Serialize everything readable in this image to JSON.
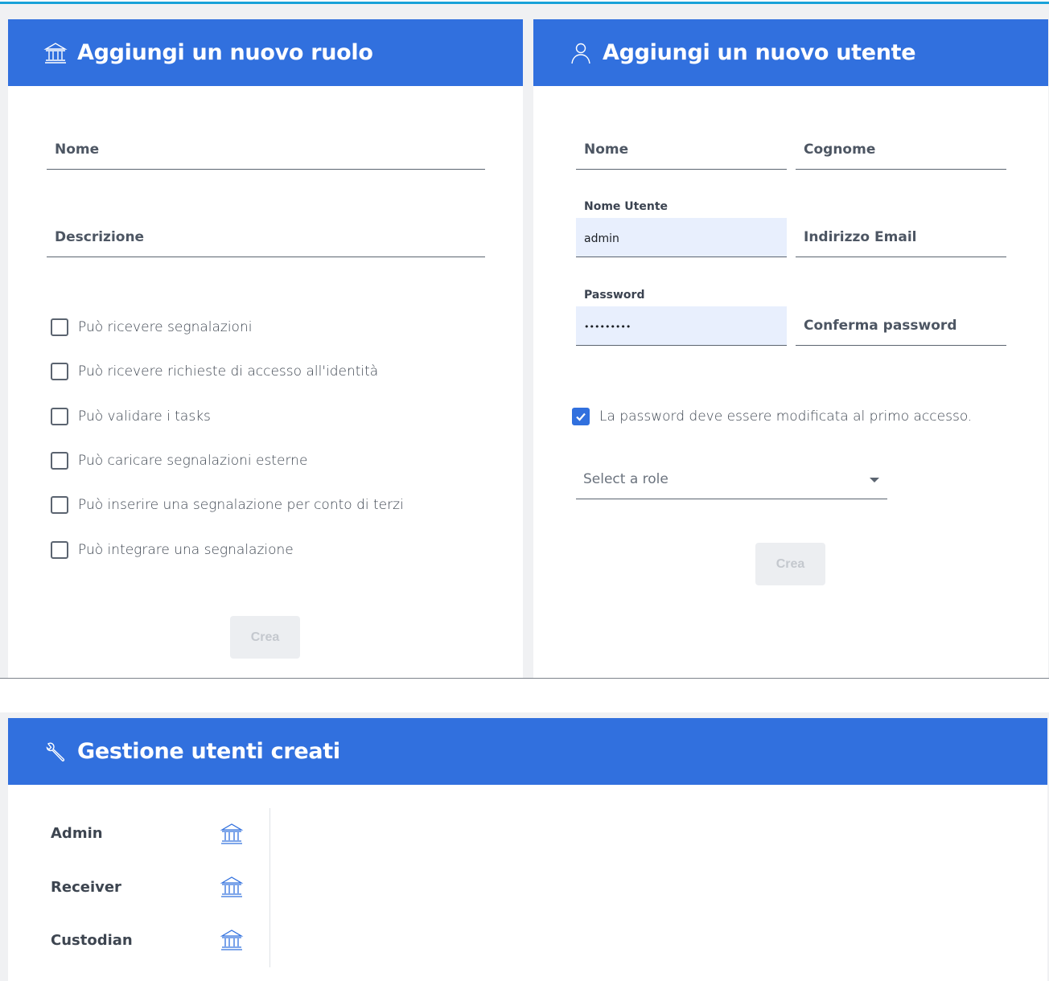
{
  "role_card": {
    "title": "Aggiungi un nuovo ruolo",
    "icon": "bank-icon",
    "name_placeholder": "Nome",
    "description_placeholder": "Descrizione",
    "checkboxes": [
      {
        "label": "Può ricevere segnalazioni",
        "checked": false
      },
      {
        "label": "Può ricevere richieste di accesso all'identità",
        "checked": false
      },
      {
        "label": "Può validare i tasks",
        "checked": false
      },
      {
        "label": "Può caricare segnalazioni esterne",
        "checked": false
      },
      {
        "label": "Può inserire una segnalazione per conto di terzi",
        "checked": false
      },
      {
        "label": "Può integrare una segnalazione",
        "checked": false
      }
    ],
    "create_label": "Crea"
  },
  "user_card": {
    "title": "Aggiungi un nuovo utente",
    "icon": "user-icon",
    "name_placeholder": "Nome",
    "surname_placeholder": "Cognome",
    "username_label": "Nome Utente",
    "username_value": "admin",
    "email_placeholder": "Indirizzo Email",
    "password_label": "Password",
    "password_value": "•••••••••",
    "confirm_password_placeholder": "Conferma password",
    "change_password_label": "La password deve essere modificata al primo accesso.",
    "change_password_checked": true,
    "role_select_placeholder": "Select a role",
    "create_label": "Crea"
  },
  "manage_card": {
    "title": "Gestione utenti creati",
    "icon": "wrench-icon",
    "roles": [
      {
        "name": "Admin",
        "icon": "bank-icon"
      },
      {
        "name": "Receiver",
        "icon": "bank-icon"
      },
      {
        "name": "Custodian",
        "icon": "bank-icon"
      }
    ]
  },
  "colors": {
    "header_blue": "#3170de",
    "top_accent": "#19a2d8",
    "filled_field": "#e8effd"
  }
}
